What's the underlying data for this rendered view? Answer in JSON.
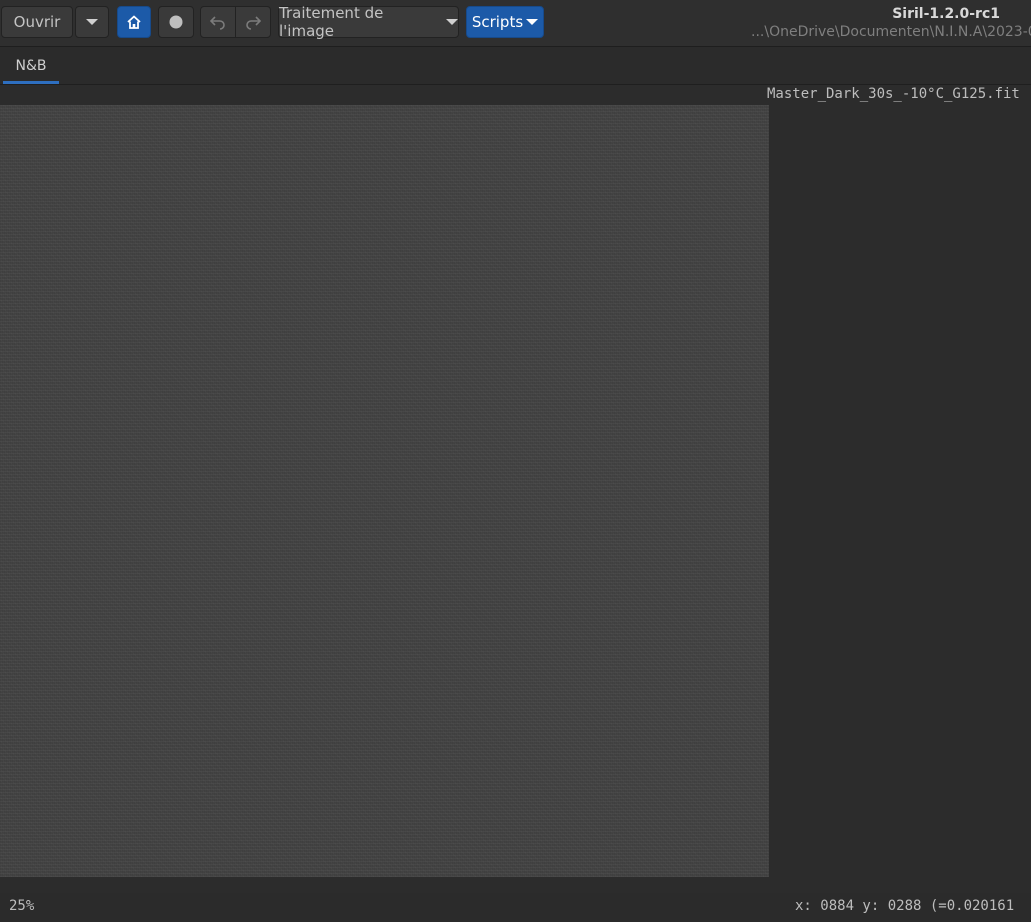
{
  "toolbar": {
    "open_label": "Ouvrir",
    "image_processing_label": "Traitement de l'image",
    "scripts_label": "Scripts"
  },
  "header": {
    "title": "Siril-1.2.0-rc1",
    "subtitle": "...\\OneDrive\\Documenten\\N.I.N.A\\2023-0"
  },
  "tabs": [
    {
      "label": "N&B",
      "active": true
    }
  ],
  "image": {
    "filename": "Master_Dark_30s_-10°C_G125.fit"
  },
  "status": {
    "zoom": "25%",
    "coordinates": "x: 0884 y: 0288 (=0.020161"
  },
  "colors": {
    "accent": "#1c5aa8",
    "tab_underline": "#2e6fc0",
    "background": "#2b2b2b"
  }
}
